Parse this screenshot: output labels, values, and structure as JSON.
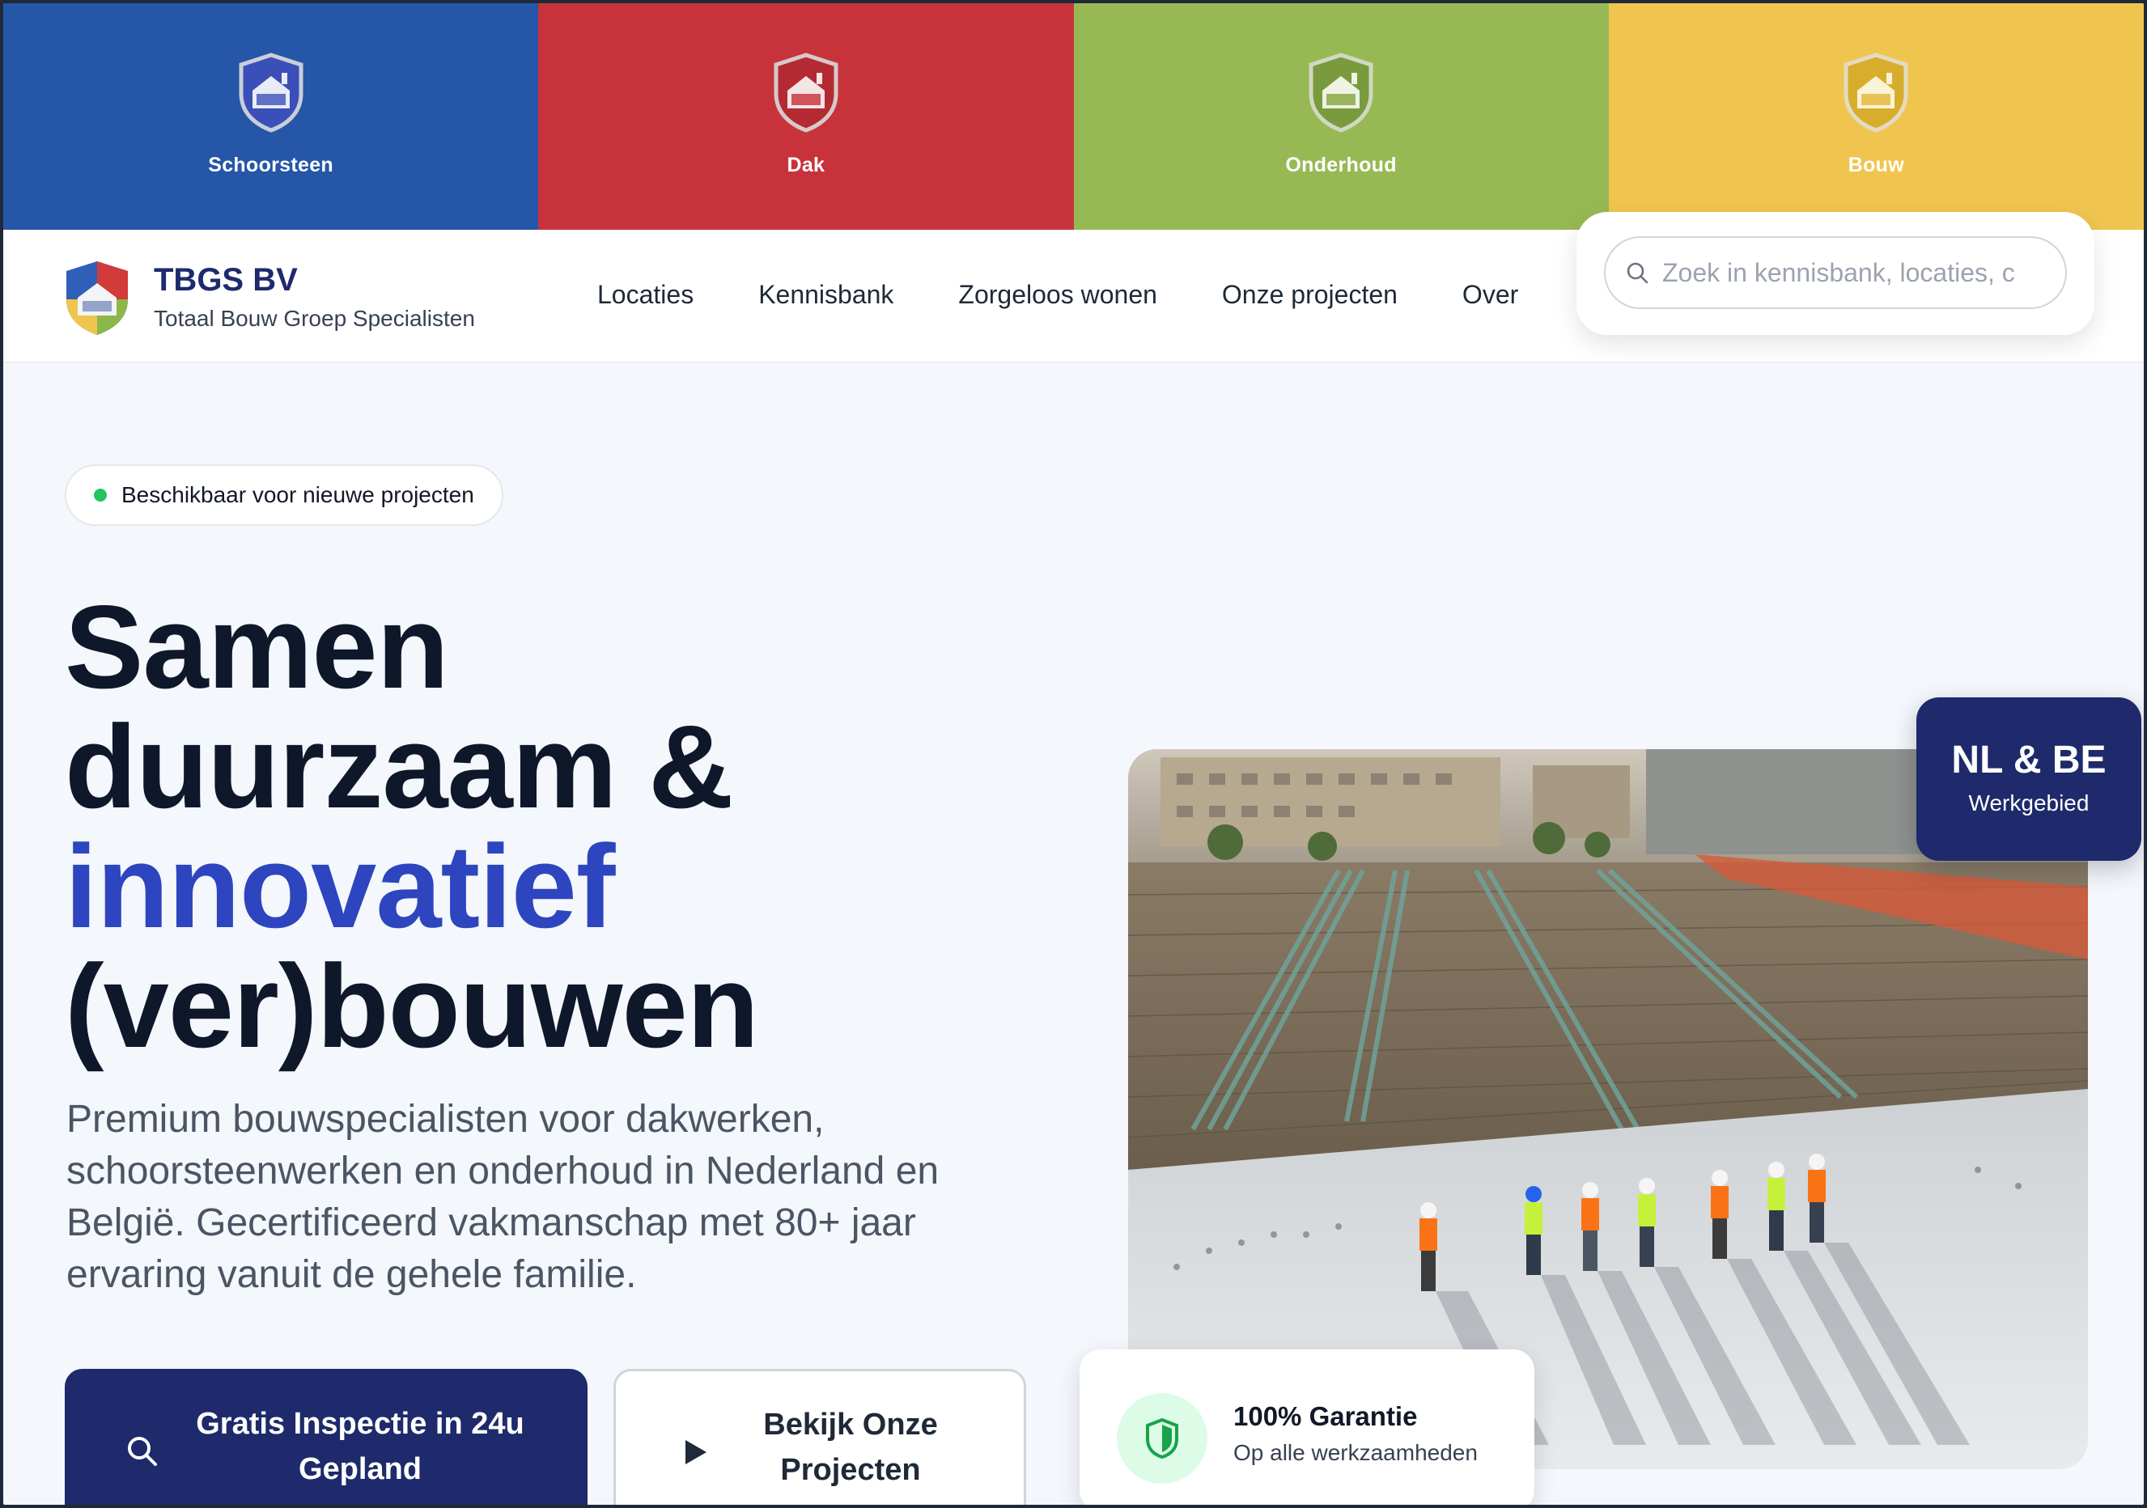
{
  "divisions": [
    {
      "label": "Schoorsteen",
      "color": "#2556a8",
      "icon": "tbgs-shield-blue-icon"
    },
    {
      "label": "Dak",
      "color": "#c8333b",
      "icon": "tbgs-shield-red-icon"
    },
    {
      "label": "Onderhoud",
      "color": "#97b954",
      "icon": "tbgs-shield-green-icon"
    },
    {
      "label": "Bouw",
      "color": "#f0c54f",
      "icon": "tbgs-shield-yellow-icon"
    }
  ],
  "header": {
    "brand_name": "TBGS BV",
    "brand_sub": "Totaal Bouw Groep Specialisten",
    "nav": [
      "Locaties",
      "Kennisbank",
      "Zorgeloos wonen",
      "Onze projecten",
      "Over"
    ],
    "search_placeholder": "Zoek in kennisbank, locaties, c"
  },
  "hero": {
    "badge": "Beschikbaar voor nieuwe projecten",
    "headline_1": "Samen",
    "headline_2": "duurzaam &",
    "headline_accent": "innovatief",
    "headline_3": "(ver)bouwen",
    "intro": "Premium bouwspecialisten voor dakwerken, schoorsteenwerken en onderhoud in Nederland en België. Gecertificeerd vakmanschap met 80+ jaar ervaring vanuit de gehele familie.",
    "primary_button": "Gratis Inspectie in 24u Gepland",
    "secondary_button": "Bekijk Onze Projecten"
  },
  "region": {
    "title": "NL & BE",
    "subtitle": "Werkgebied"
  },
  "guarantee": {
    "title": "100% Garantie",
    "subtitle": "Op alle werkzaamheden"
  },
  "colors": {
    "brand_navy": "#1e2a6b",
    "accent_blue": "#2d45bf",
    "status_green": "#22c55e"
  }
}
